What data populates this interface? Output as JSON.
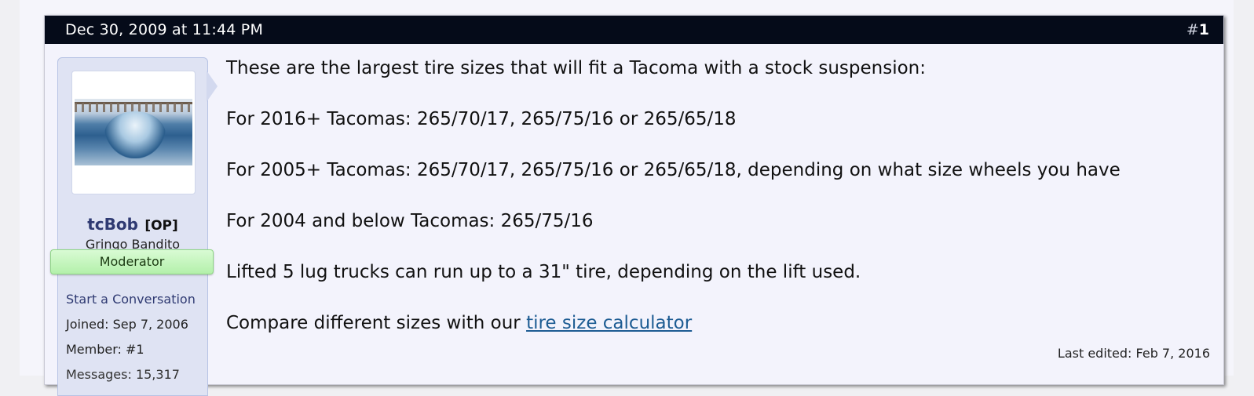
{
  "post": {
    "date": "Dec 30, 2009 at 11:44 PM",
    "number_hash": "#",
    "number": "1",
    "last_edited": "Last edited: Feb 7, 2016",
    "body": {
      "line1": "These are the largest tire sizes that will fit a Tacoma with a stock suspension:",
      "line2": "For 2016+ Tacomas: 265/70/17, 265/75/16 or 265/65/18",
      "line3": "For 2005+ Tacomas: 265/70/17, 265/75/16 or 265/65/18, depending on what size wheels you have",
      "line4": "For 2004 and below Tacomas: 265/75/16",
      "line5": "Lifted 5 lug trucks can run up to a 31\" tire, depending on the lift used.",
      "line6_prefix": "Compare different sizes with our ",
      "line6_link": "tire size calculator"
    }
  },
  "user": {
    "avatar": "surfing-wave-avatar",
    "name": "tcBob",
    "op_badge": "[OP]",
    "title": "Gringo Bandito",
    "banner": "Moderator",
    "start_conversation": "Start a Conversation",
    "joined": "Joined:  Sep 7, 2006",
    "member": "Member:  #1",
    "messages": "Messages:  15,317"
  },
  "colors": {
    "header_bg": "#050b19",
    "username": "#2f3a72",
    "link": "#1d5c93",
    "banner_bg": "#b3f0aa"
  }
}
